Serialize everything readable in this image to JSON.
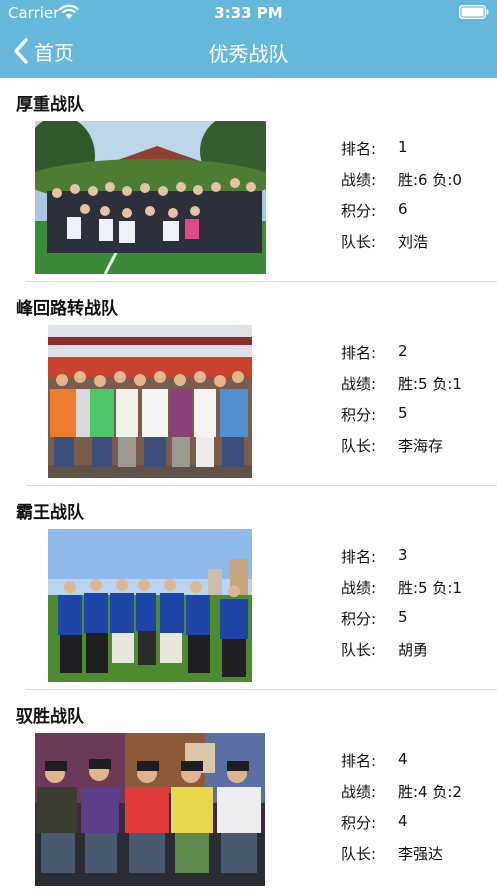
{
  "status_bar": {
    "carrier": "Carrier",
    "time": "3:33 PM"
  },
  "nav": {
    "back_label": "首页",
    "title": "优秀战队"
  },
  "labels": {
    "rank": "排名:",
    "record": "战绩:",
    "points": "积分:",
    "captain": "队长:"
  },
  "teams": [
    {
      "name": "厚重战队",
      "rank": "1",
      "record": "胜:6 负:0",
      "points": "6",
      "captain": "刘浩"
    },
    {
      "name": "峰回路转战队",
      "rank": "2",
      "record": "胜:5 负:1",
      "points": "5",
      "captain": "李海存"
    },
    {
      "name": "霸王战队",
      "rank": "3",
      "record": "胜:5 负:1",
      "points": "5",
      "captain": "胡勇"
    },
    {
      "name": "驭胜战队",
      "rank": "4",
      "record": "胜:4 负:2",
      "points": "4",
      "captain": "李强达"
    }
  ]
}
